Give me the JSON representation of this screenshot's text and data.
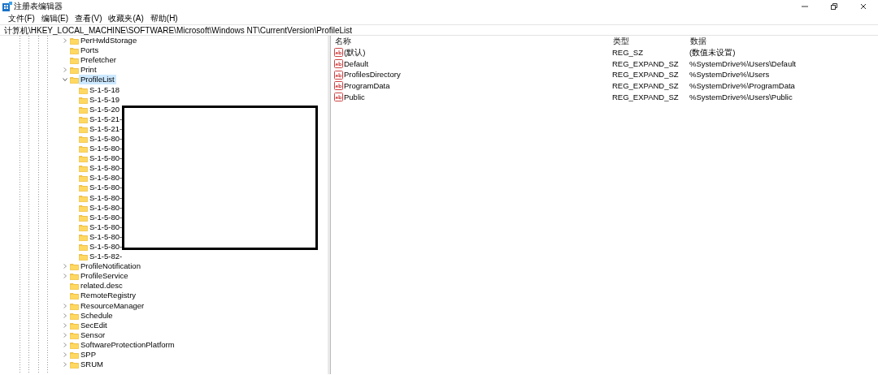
{
  "window": {
    "title": "注册表编辑器"
  },
  "menu": [
    "文件(F)",
    "编辑(E)",
    "查看(V)",
    "收藏夹(A)",
    "帮助(H)"
  ],
  "address": "计算机\\HKEY_LOCAL_MACHINE\\SOFTWARE\\Microsoft\\Windows NT\\CurrentVersion\\ProfileList",
  "tree": [
    {
      "label": "PerHwldStorage",
      "expanded": false,
      "selected": false
    },
    {
      "label": "Ports",
      "selected": false
    },
    {
      "label": "Prefetcher",
      "selected": false
    },
    {
      "label": "Print",
      "expanded": false,
      "selected": false
    },
    {
      "label": "ProfileList",
      "expanded": true,
      "selected": true,
      "children": [
        {
          "label": "S-1-5-18",
          "selected": false
        },
        {
          "label": "S-1-5-19",
          "selected": false
        },
        {
          "label": "S-1-5-20",
          "selected": false
        },
        {
          "label": "S-1-5-21-",
          "selected": false
        },
        {
          "label": "S-1-5-21-",
          "selected": false
        },
        {
          "label": "S-1-5-80-",
          "selected": false
        },
        {
          "label": "S-1-5-80-",
          "selected": false
        },
        {
          "label": "S-1-5-80-",
          "selected": false
        },
        {
          "label": "S-1-5-80-",
          "selected": false
        },
        {
          "label": "S-1-5-80-",
          "selected": false
        },
        {
          "label": "S-1-5-80-",
          "selected": false
        },
        {
          "label": "S-1-5-80-",
          "selected": false
        },
        {
          "label": "S-1-5-80-",
          "selected": false
        },
        {
          "label": "S-1-5-80-",
          "selected": false
        },
        {
          "label": "S-1-5-80-",
          "selected": false
        },
        {
          "label": "S-1-5-80-",
          "selected": false
        },
        {
          "label": "S-1-5-80-",
          "selected": false
        },
        {
          "label": "S-1-5-82-",
          "selected": false
        }
      ]
    },
    {
      "label": "ProfileNotification",
      "expanded": false,
      "selected": false
    },
    {
      "label": "ProfileService",
      "expanded": false,
      "selected": false
    },
    {
      "label": "related.desc",
      "selected": false
    },
    {
      "label": "RemoteRegistry",
      "selected": false
    },
    {
      "label": "ResourceManager",
      "expanded": false,
      "selected": false
    },
    {
      "label": "Schedule",
      "expanded": false,
      "selected": false
    },
    {
      "label": "SecEdit",
      "expanded": false,
      "selected": false
    },
    {
      "label": "Sensor",
      "expanded": false,
      "selected": false
    },
    {
      "label": "SoftwareProtectionPlatform",
      "expanded": false,
      "selected": false
    },
    {
      "label": "SPP",
      "expanded": false,
      "selected": false
    },
    {
      "label": "SRUM",
      "expanded": false,
      "selected": false
    }
  ],
  "values": {
    "columns": [
      "名称",
      "类型",
      "数据"
    ],
    "rows": [
      {
        "name": "(默认)",
        "type": "REG_SZ",
        "data": "(数值未设置)"
      },
      {
        "name": "Default",
        "type": "REG_EXPAND_SZ",
        "data": "%SystemDrive%\\Users\\Default"
      },
      {
        "name": "ProfilesDirectory",
        "type": "REG_EXPAND_SZ",
        "data": "%SystemDrive%\\Users"
      },
      {
        "name": "ProgramData",
        "type": "REG_EXPAND_SZ",
        "data": "%SystemDrive%\\ProgramData"
      },
      {
        "name": "Public",
        "type": "REG_EXPAND_SZ",
        "data": "%SystemDrive%\\Users\\Public"
      }
    ]
  }
}
